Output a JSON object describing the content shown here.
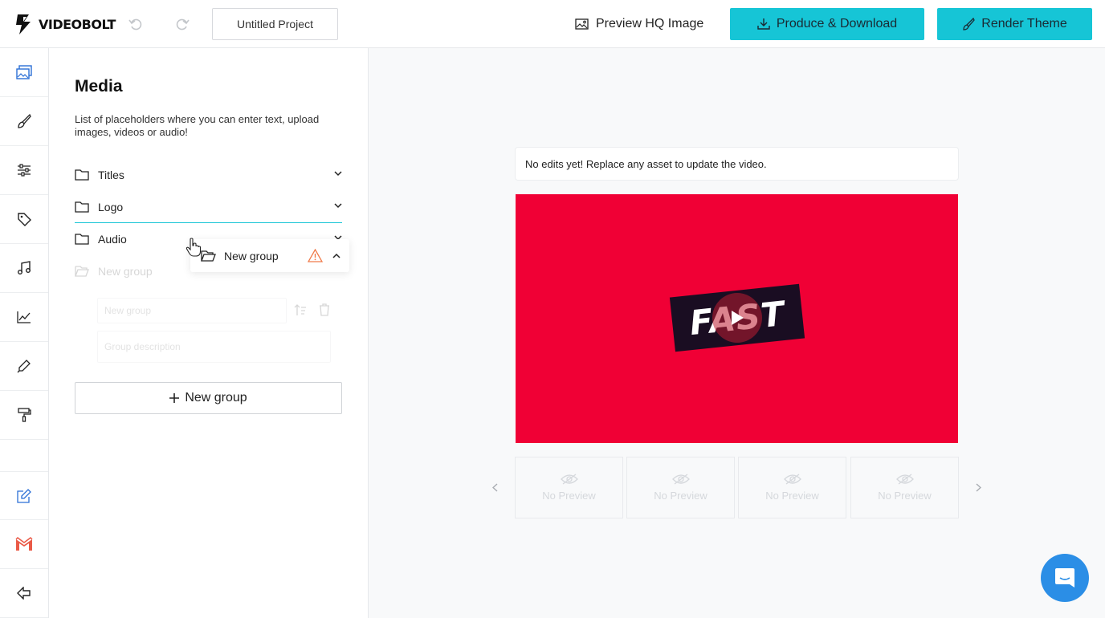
{
  "app": {
    "logo_text": "VIDEOBOLT",
    "project_name": "Untitled Project"
  },
  "toolbar": {
    "preview_hq_label": "Preview HQ Image",
    "produce_label": "Produce & Download",
    "render_label": "Render Theme",
    "accent_color": "#16c5d6"
  },
  "rail": {
    "items": [
      "media-icon",
      "brush-icon",
      "sliders-icon",
      "tag-icon",
      "music-icon",
      "chart-icon",
      "pen-icon",
      "paint-roller-icon",
      "edit-icon",
      "gmail-icon",
      "exit-icon"
    ]
  },
  "panel": {
    "title": "Media",
    "description": "List of placeholders where you can enter text, upload images, videos or audio!",
    "groups": [
      {
        "label": "Titles"
      },
      {
        "label": "Logo"
      },
      {
        "label": "Audio"
      },
      {
        "label": "New group"
      }
    ],
    "ghost_name_placeholder": "New group",
    "ghost_desc_placeholder": "Group description",
    "new_group_label": "New group"
  },
  "drag_card": {
    "label": "New group"
  },
  "preview": {
    "notice": "No edits yet! Replace any asset to update the video.",
    "video_text": "FAST",
    "video_bg": "#f00035",
    "thumbnails": [
      {
        "label": "No Preview"
      },
      {
        "label": "No Preview"
      },
      {
        "label": "No Preview"
      },
      {
        "label": "No Preview"
      }
    ]
  }
}
